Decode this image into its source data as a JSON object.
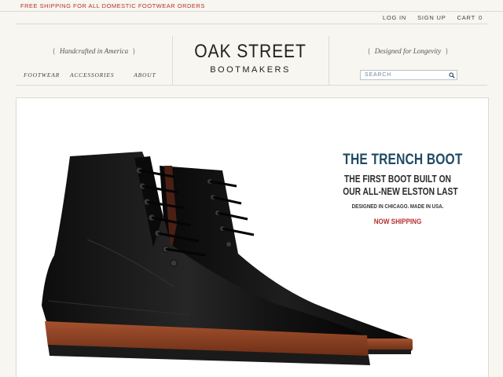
{
  "promo": {
    "text": "FREE SHIPPING FOR ALL DOMESTIC FOOTWEAR ORDERS",
    "color": "#b5322f"
  },
  "utility_nav": {
    "login": "LOG IN",
    "signup": "SIGN UP",
    "cart": "CART",
    "cart_count": "0"
  },
  "header": {
    "tagline_left": "Handcrafted in America",
    "tagline_right": "Designed for Longevity",
    "brace_open": "{",
    "brace_close": "}",
    "logo_line1": "OAK STREET",
    "logo_line2": "BOOTMAKERS",
    "nav": {
      "footwear": "FOOTWEAR",
      "accessories": "ACCESSORIES",
      "about": "ABOUT"
    },
    "search": {
      "placeholder": "SEARCH",
      "icon": "search-icon"
    }
  },
  "hero": {
    "title": "THE TRENCH BOOT",
    "subtitle_line1": "THE FIRST BOOT BUILT ON",
    "subtitle_line2": "OUR ALL-NEW ELSTON LAST",
    "meta": "DESIGNED IN CHICAGO. MADE IN USA.",
    "cta": "NOW SHIPPING",
    "title_color": "#1f4a63",
    "cta_color": "#b5322f",
    "image": "black-leather-trench-boots"
  }
}
